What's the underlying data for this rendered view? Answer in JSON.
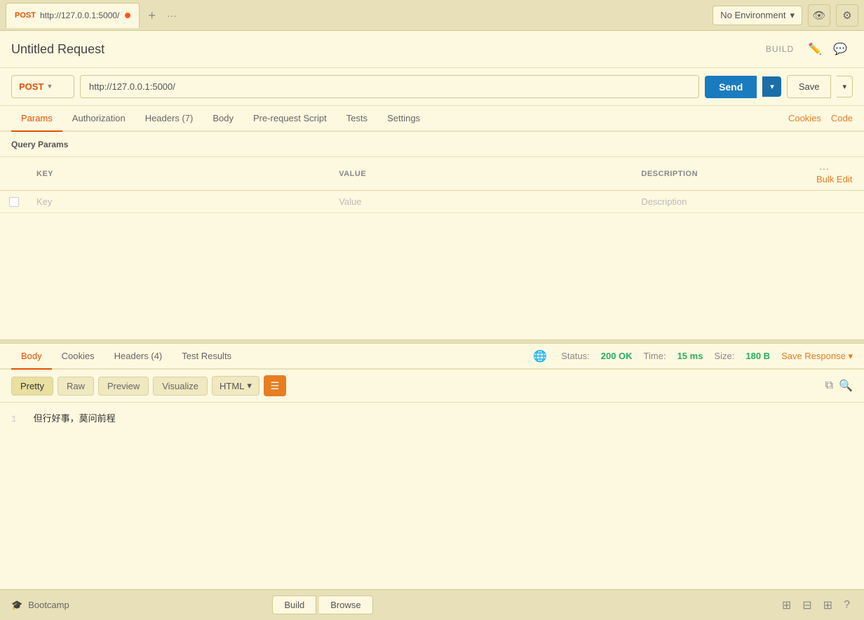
{
  "tabs": [
    {
      "method": "POST",
      "url": "http://127.0.0.1:5000/",
      "has_dot": true
    }
  ],
  "environment": {
    "label": "No Environment",
    "placeholder": "No Environment"
  },
  "request": {
    "title": "Untitled Request",
    "build_label": "BUILD",
    "method": "POST",
    "url": "http://127.0.0.1:5000/",
    "send_label": "Send",
    "save_label": "Save"
  },
  "req_tabs": {
    "items": [
      "Params",
      "Authorization",
      "Headers (7)",
      "Body",
      "Pre-request Script",
      "Tests",
      "Settings"
    ],
    "active": "Params",
    "right_links": [
      "Cookies",
      "Code"
    ]
  },
  "params": {
    "section_title": "Query Params",
    "columns": {
      "key": "KEY",
      "value": "VALUE",
      "description": "DESCRIPTION"
    },
    "bulk_edit_label": "Bulk Edit",
    "placeholder_key": "Key",
    "placeholder_value": "Value",
    "placeholder_desc": "Description"
  },
  "response": {
    "tabs": [
      "Body",
      "Cookies",
      "Headers (4)",
      "Test Results"
    ],
    "active_tab": "Body",
    "status": {
      "label": "Status:",
      "value": "200 OK",
      "time_label": "Time:",
      "time_value": "15 ms",
      "size_label": "Size:",
      "size_value": "180 B"
    },
    "save_response_label": "Save Response",
    "format_tabs": [
      "Pretty",
      "Raw",
      "Preview",
      "Visualize"
    ],
    "active_format": "Pretty",
    "format_type": "HTML",
    "line_number": "1",
    "content": "但行好事，莫问前程"
  },
  "footer": {
    "bootcamp_icon": "🎓",
    "bootcamp_label": "Bootcamp",
    "build_label": "Build",
    "browse_label": "Browse"
  }
}
